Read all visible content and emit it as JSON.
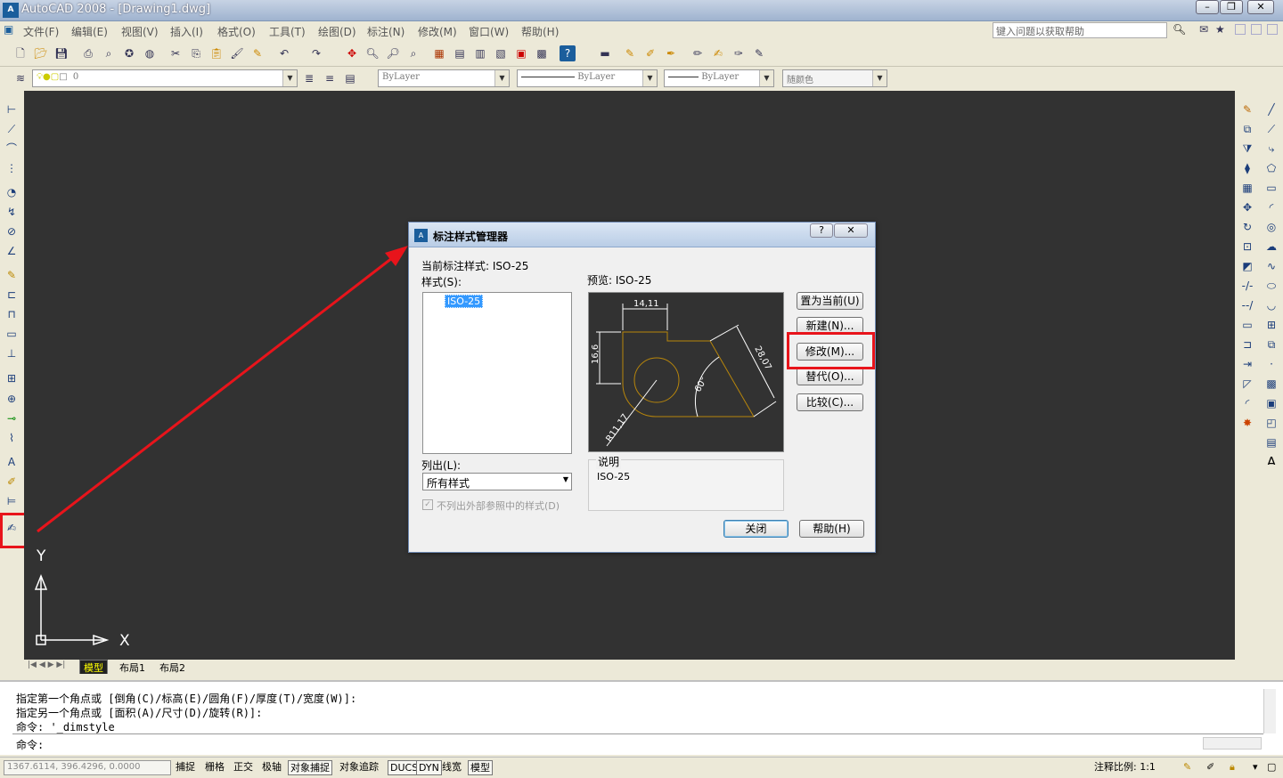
{
  "window": {
    "title": "AutoCAD 2008 - [Drawing1.dwg]",
    "logo": "A"
  },
  "menu": {
    "items": [
      "文件(F)",
      "编辑(E)",
      "视图(V)",
      "插入(I)",
      "格式(O)",
      "工具(T)",
      "绘图(D)",
      "标注(N)",
      "修改(M)",
      "窗口(W)",
      "帮助(H)"
    ]
  },
  "help": {
    "placeholder": "键入问题以获取帮助"
  },
  "layers": {
    "current": "0"
  },
  "properties": {
    "color": "ByLayer",
    "linetype": "ByLayer",
    "lineweight": "ByLayer",
    "plotstyle": "随颜色"
  },
  "tabs": {
    "model": "模型",
    "layout1": "布局1",
    "layout2": "布局2"
  },
  "ucs": {
    "y": "Y",
    "x": "X"
  },
  "command": {
    "line1": "指定第一个角点或 [倒角(C)/标高(E)/圆角(F)/厚度(T)/宽度(W)]:",
    "line2": "指定另一个角点或 [面积(A)/尺寸(D)/旋转(R)]:",
    "line3": "命令: '_dimstyle",
    "prompt": "命令:"
  },
  "status": {
    "coords": "1367.6114, 396.4296, 0.0000",
    "buttons": [
      "捕捉",
      "栅格",
      "正交",
      "极轴",
      "对象捕捉",
      "对象追踪",
      "DUCS",
      "DYN",
      "线宽",
      "模型"
    ],
    "scale_label": "注释比例: 1:1"
  },
  "dialog": {
    "title": "标注样式管理器",
    "current_style": "当前标注样式: ISO-25",
    "styles_label": "样式(S):",
    "styles": [
      "ISO-25"
    ],
    "preview_label": "预览: ISO-25",
    "list_label": "列出(L):",
    "list_value": "所有样式",
    "xref_checkbox": "不列出外部参照中的样式(D)",
    "buttons": {
      "set_current": "置为当前(U)",
      "new": "新建(N)...",
      "modify": "修改(M)...",
      "override": "替代(O)...",
      "compare": "比较(C)..."
    },
    "desc_label": "说明",
    "desc_value": "ISO-25",
    "close": "关闭",
    "help": "帮助(H)",
    "preview_dims": {
      "top": "14,11",
      "left": "16,6",
      "diag": "28,07",
      "angle": "60°",
      "radius": "R11,17"
    }
  },
  "annotation": {
    "arrow_color": "#e8141b"
  }
}
